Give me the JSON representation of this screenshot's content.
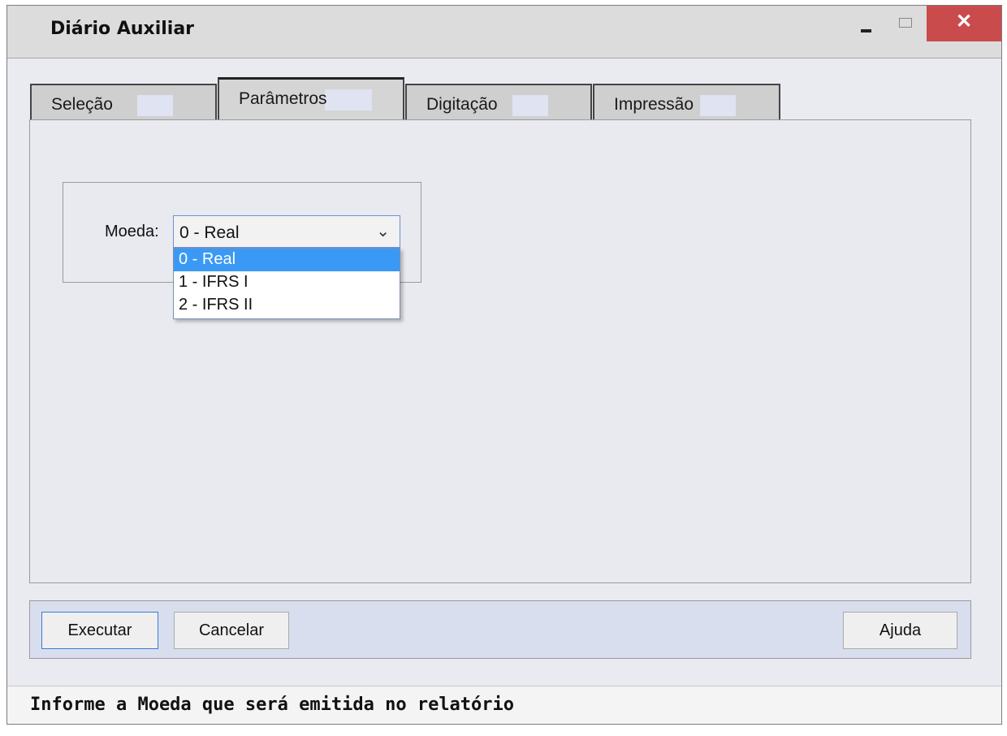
{
  "window": {
    "title": "Diário Auxiliar",
    "close_glyph": "✕"
  },
  "tabs": [
    {
      "label": "Seleção",
      "active": false
    },
    {
      "label": "Parâmetros",
      "active": true
    },
    {
      "label": "Digitação",
      "active": false
    },
    {
      "label": "Impressão",
      "active": false
    }
  ],
  "parametros": {
    "moeda_label": "Moeda:",
    "moeda_selected": "0 - Real",
    "moeda_options": [
      "0 - Real",
      "1 - IFRS I",
      "2 - IFRS II"
    ],
    "dropdown_open": true,
    "chevron_icon": "chevron-down-icon"
  },
  "buttons": {
    "executar": "Executar",
    "cancelar": "Cancelar",
    "ajuda": "Ajuda"
  },
  "status": {
    "message": "Informe a Moeda que será emitida no relatório"
  },
  "colors": {
    "selected_option": "#3a99f5",
    "close_button": "#c94b4b"
  }
}
